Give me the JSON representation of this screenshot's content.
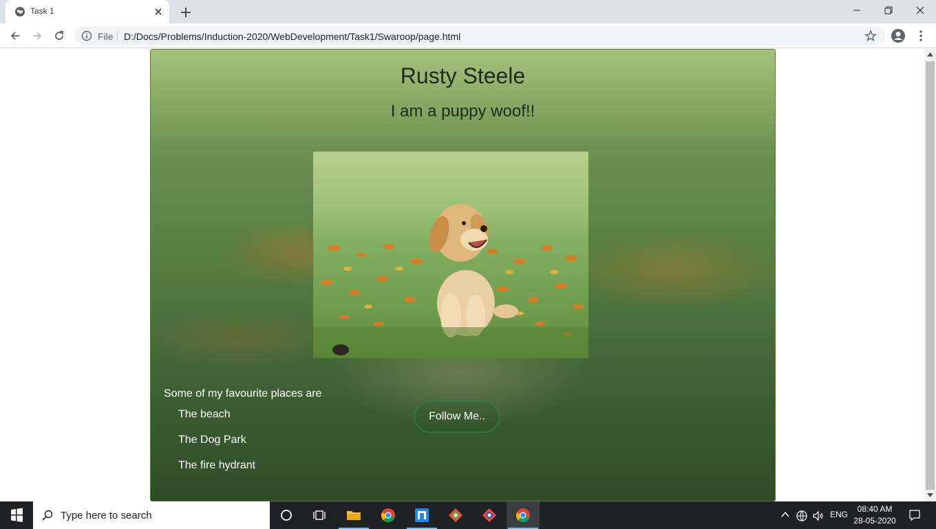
{
  "browser": {
    "tab_title": "Task 1",
    "scheme_label": "File",
    "url": "D:/Docs/Problems/Induction-2020/WebDevelopment/Task1/Swaroop/page.html"
  },
  "page": {
    "title": "Rusty Steele",
    "subtitle": "I am a puppy woof!!",
    "places_intro": "Some of my favourite places are",
    "places": [
      "The beach",
      "The Dog Park",
      "The fire hydrant"
    ],
    "follow_label": "Follow Me.."
  },
  "taskbar": {
    "search_placeholder": "Type here to search",
    "language": "ENG",
    "time": "08:40 AM",
    "date": "28-05-2020",
    "apps": [
      "cortana-icon",
      "task-view-icon",
      "file-explorer-icon",
      "chrome-icon",
      "app-icon",
      "git-icon",
      "git-icon",
      "chrome-icon"
    ]
  },
  "colors": {
    "tabstrip": "#dee1e6",
    "taskbar": "#1f2124",
    "follow_border": "#2f8a46"
  }
}
